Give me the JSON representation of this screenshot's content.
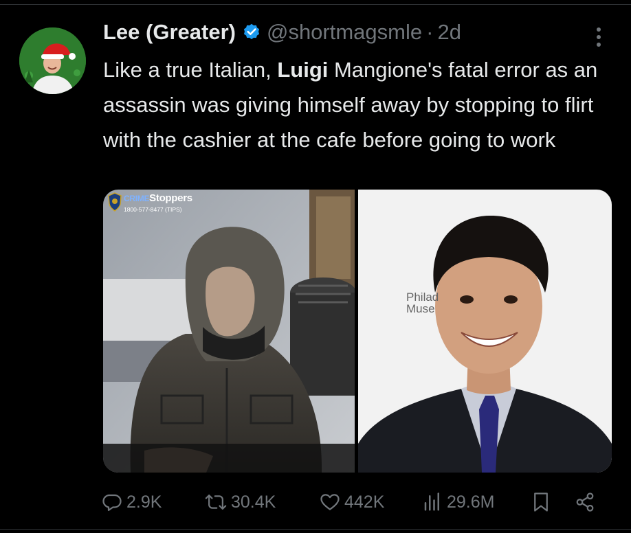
{
  "post": {
    "display_name": "Lee (Greater)",
    "handle": "@shortmagsmle",
    "separator": "·",
    "age": "2d",
    "text_parts": {
      "before_bold": "Like a true Italian, ",
      "bold": "Luigi",
      "after_bold": " Mangione's fatal error as an assassin was giving himself away by stopping to flirt with the cashier at the cafe before going to work"
    }
  },
  "media": {
    "left": {
      "logo_title_prefix": "CRIME",
      "logo_title_suffix": "Stoppers",
      "logo_phone": "1800-577-8477 (TIPS)"
    },
    "right": {
      "backdrop_line1": "Philad",
      "backdrop_line2": "Muse"
    }
  },
  "actions": {
    "replies": "2.9K",
    "reposts": "30.4K",
    "likes": "442K",
    "views": "29.6M"
  },
  "colors": {
    "background": "#000000",
    "text_primary": "#e7e9ea",
    "text_secondary": "#71767b",
    "verified_blue": "#1d9bf0"
  },
  "icons": [
    "more-icon",
    "verified-badge-icon",
    "reply-icon",
    "repost-icon",
    "like-icon",
    "views-icon",
    "bookmark-icon",
    "share-icon"
  ]
}
